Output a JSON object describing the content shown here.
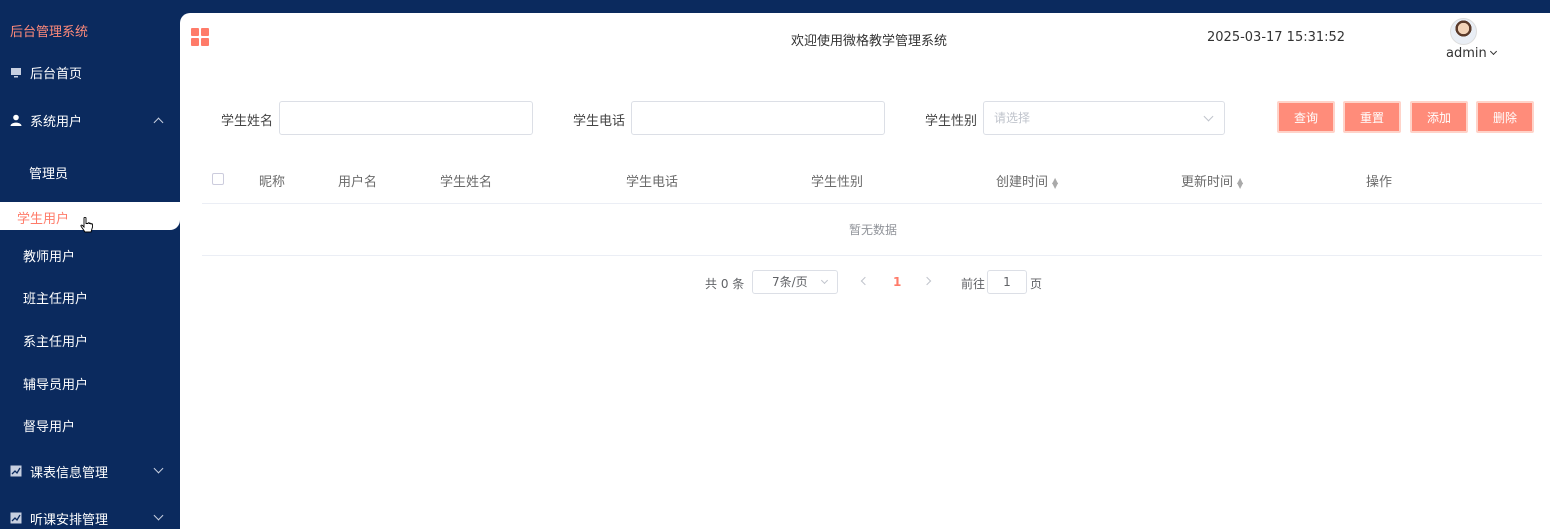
{
  "sidebar": {
    "brand": "后台管理系统",
    "home": "后台首页",
    "system_users": "系统用户",
    "sub_items": [
      "管理员",
      "学生用户",
      "教师用户",
      "班主任用户",
      "系主任用户",
      "辅导员用户",
      "督导用户"
    ],
    "schedule": "课表信息管理",
    "lecture": "听课安排管理"
  },
  "header": {
    "welcome": "欢迎使用微格教学管理系统",
    "datetime": "2025-03-17 15:31:52",
    "user": "admin"
  },
  "search": {
    "name_label": "学生姓名",
    "phone_label": "学生电话",
    "gender_label": "学生性别",
    "gender_placeholder": "请选择",
    "buttons": [
      "查询",
      "重置",
      "添加",
      "删除"
    ]
  },
  "table": {
    "headers": [
      "昵称",
      "用户名",
      "学生姓名",
      "学生电话",
      "学生性别",
      "创建时间",
      "更新时间",
      "操作"
    ],
    "empty_text": "暂无数据"
  },
  "pagination": {
    "total": "共 0 条",
    "page_size": "7条/页",
    "current_page": "1",
    "goto_label": "前往",
    "goto_value": "1",
    "page_suffix": "页"
  },
  "colors": {
    "accent": "#ff7b69",
    "sidebar": "#0b2a5e"
  }
}
